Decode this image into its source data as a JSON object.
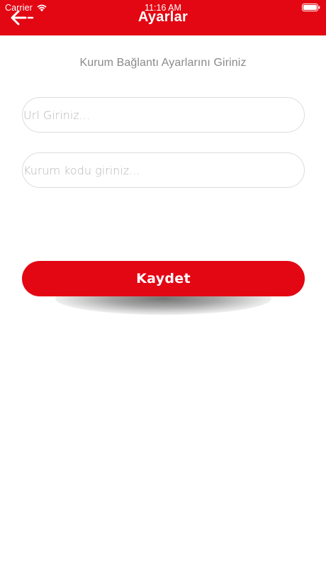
{
  "status_bar": {
    "carrier": "Carrier",
    "time": "11:16 AM",
    "wifi_icon": "wifi-icon",
    "battery_icon": "battery-icon"
  },
  "nav": {
    "title": "Ayarlar",
    "back_icon": "arrow-left-icon"
  },
  "form": {
    "subtitle": "Kurum Bağlantı Ayarlarını Giriniz",
    "url_field": {
      "value": "",
      "placeholder": "Url Giriniz..."
    },
    "code_field": {
      "value": "",
      "placeholder": "Kurum kodu giriniz..."
    },
    "save_label": "Kaydet"
  },
  "colors": {
    "brand_red": "#e30613",
    "background": "#ffffff",
    "subtitle_text": "#8a8a8a",
    "placeholder_text": "#b7b7b7",
    "field_border": "#dcdcdc"
  }
}
